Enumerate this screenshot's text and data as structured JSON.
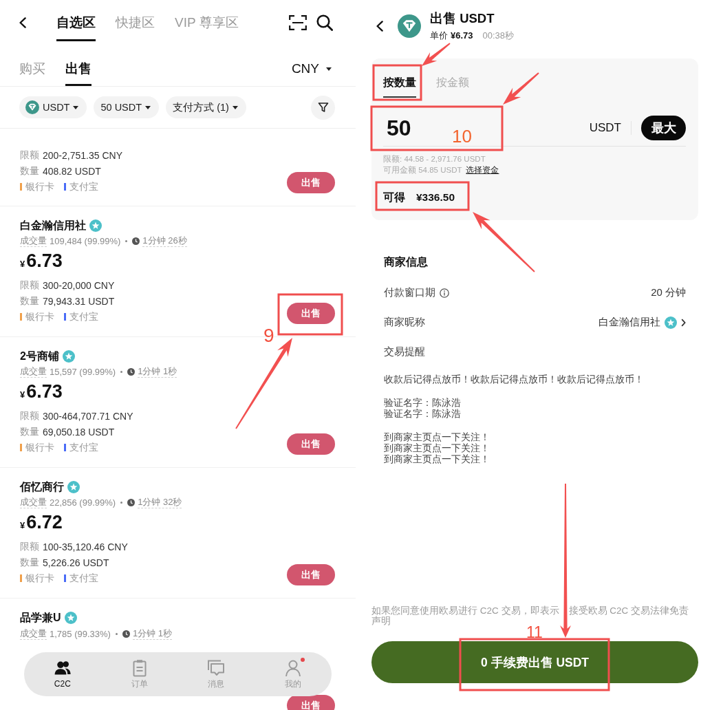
{
  "left_screen": {
    "header_tabs": [
      {
        "label": "自选区",
        "selected": true
      },
      {
        "label": "快捷区",
        "selected": false
      },
      {
        "label": "VIP 尊享区",
        "selected": false
      }
    ],
    "trade_tabs": [
      {
        "label": "购买",
        "selected": false
      },
      {
        "label": "出售",
        "selected": true
      }
    ],
    "currency": "CNY",
    "filters": [
      {
        "label": "USDT",
        "kind": "coin"
      },
      {
        "label": "50 USDT",
        "kind": "plain"
      },
      {
        "label": "支付方式 (1)",
        "kind": "plain"
      }
    ],
    "offers": [
      {
        "limit_label": "限额",
        "limit": "200-2,751.35 CNY",
        "quantity_label": "数量",
        "quantity": "408.82 USDT",
        "payments": [
          {
            "label": "银行卡",
            "color": "#f0a04b"
          },
          {
            "label": "支付宝",
            "color": "#4a6cf7"
          }
        ],
        "action": "出售"
      },
      {
        "merchant": "白金瀚信用社",
        "verified": true,
        "volume_label": "成交量",
        "volume": "109,484 (99.99%)",
        "time": "1分钟 26秒",
        "currency_symbol": "¥",
        "price": "6.73",
        "limit_label": "限额",
        "limit": "300-20,000 CNY",
        "quantity_label": "数量",
        "quantity": "79,943.31 USDT",
        "payments": [
          {
            "label": "银行卡",
            "color": "#f0a04b"
          },
          {
            "label": "支付宝",
            "color": "#4a6cf7"
          }
        ],
        "action": "出售"
      },
      {
        "merchant": "2号商铺",
        "verified": true,
        "volume_label": "成交量",
        "volume": "15,597 (99.99%)",
        "time": "1分钟 1秒",
        "currency_symbol": "¥",
        "price": "6.73",
        "limit_label": "限额",
        "limit": "300-464,707.71 CNY",
        "quantity_label": "数量",
        "quantity": "69,050.18 USDT",
        "payments": [
          {
            "label": "银行卡",
            "color": "#f0a04b"
          },
          {
            "label": "支付宝",
            "color": "#4a6cf7"
          }
        ],
        "action": "出售"
      },
      {
        "merchant": "佰忆商行",
        "verified": true,
        "volume_label": "成交量",
        "volume": "22,856 (99.99%)",
        "time": "1分钟 32秒",
        "currency_symbol": "¥",
        "price": "6.72",
        "limit_label": "限额",
        "limit": "100-35,120.46 CNY",
        "quantity_label": "数量",
        "quantity": "5,226.26 USDT",
        "payments": [
          {
            "label": "银行卡",
            "color": "#f0a04b"
          },
          {
            "label": "支付宝",
            "color": "#4a6cf7"
          }
        ],
        "action": "出售"
      },
      {
        "merchant": "品学兼U",
        "verified": true,
        "volume_label": "成交量",
        "volume": "1,785 (99.33%)",
        "time": "1分钟 1秒",
        "action": "出售"
      }
    ],
    "nav": [
      {
        "label": "C2C",
        "kind": "people",
        "selected": true,
        "badge": false
      },
      {
        "label": "订单",
        "kind": "orders",
        "selected": false,
        "badge": false
      },
      {
        "label": "消息",
        "kind": "messages",
        "selected": false,
        "badge": false
      },
      {
        "label": "我的",
        "kind": "profile",
        "selected": false,
        "badge": true
      }
    ]
  },
  "right_screen": {
    "title": "出售 USDT",
    "unit_price_label": "单价",
    "unit_price": "¥6.73",
    "countdown": "00:38秒",
    "mode_tabs": [
      {
        "label": "按数量",
        "selected": true
      },
      {
        "label": "按金额",
        "selected": false
      }
    ],
    "amount": "50",
    "amount_unit": "USDT",
    "max_button": "最大",
    "limit_note": "限额: 44.58 - 2,971.76 USDT",
    "available_note": "可用金额 54.85 USDT",
    "funds_link": "选择资金",
    "receive_label": "可得",
    "receive_value": "¥336.50",
    "merchant_title": "商家信息",
    "merchant_rows": [
      {
        "kind": "info",
        "label": "付款窗口期",
        "value": "20 分钟"
      },
      {
        "kind": "link",
        "label": "商家昵称",
        "value": "白金瀚信用社",
        "verified": true
      },
      {
        "kind": "plain",
        "label": "交易提醒"
      }
    ],
    "remarks": [
      [
        "收款后记得点放币！收款后记得点放币！收款后记得点放币！"
      ],
      [
        "验证名字：陈泳浩",
        "验证名字：陈泳浩"
      ],
      [
        "到商家主页点一下关注！",
        "到商家主页点一下关注！",
        "到商家主页点一下关注！"
      ]
    ],
    "disclaimer_parts": [
      "如果您同意使用欧易进行 C2C 交易，即表示",
      "接受欧易 C2C 交易法律免责声明"
    ],
    "submit": "0 手续费出售 USDT"
  },
  "annotations": [
    {
      "number": "9"
    },
    {
      "number": "10"
    },
    {
      "number": "11"
    }
  ]
}
